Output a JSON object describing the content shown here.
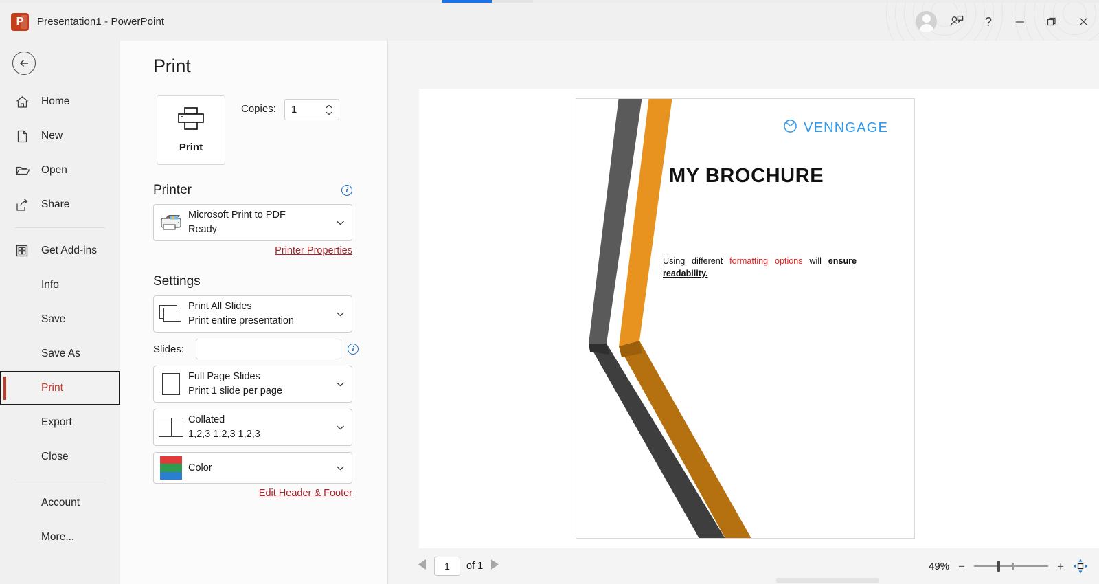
{
  "window": {
    "app_icon": "powerpoint-icon",
    "title": "Presentation1  -  PowerPoint",
    "controls": {
      "avatar": "account-avatar",
      "share_label": "person-share-icon",
      "help_label": "?",
      "minimize_label": "minimize-icon",
      "restore_label": "restore-icon",
      "close_label": "close-icon"
    }
  },
  "sidebar": {
    "back_label": "back-arrow-icon",
    "items": [
      {
        "label": "Home",
        "icon": "home-icon",
        "selected": false
      },
      {
        "label": "New",
        "icon": "page-icon",
        "selected": false
      },
      {
        "label": "Open",
        "icon": "folder-icon",
        "selected": false
      },
      {
        "label": "Share",
        "icon": "share-icon",
        "selected": false
      },
      {
        "label": "Get Add-ins",
        "icon": "addins-icon",
        "selected": false
      },
      {
        "label": "Info",
        "icon": "",
        "selected": false
      },
      {
        "label": "Save",
        "icon": "",
        "selected": false
      },
      {
        "label": "Save As",
        "icon": "",
        "selected": false
      },
      {
        "label": "Print",
        "icon": "",
        "selected": true
      },
      {
        "label": "Export",
        "icon": "",
        "selected": false
      },
      {
        "label": "Close",
        "icon": "",
        "selected": false
      },
      {
        "label": "Account",
        "icon": "",
        "selected": false
      },
      {
        "label": "More...",
        "icon": "",
        "selected": false
      }
    ],
    "selected_color": "#c0392b"
  },
  "print_pane": {
    "heading": "Print",
    "print_button_label": "Print",
    "print_button_icon": "printer-icon",
    "copies_label": "Copies:",
    "copies_value": "1",
    "printer_section": {
      "heading": "Printer",
      "info_icon": "i",
      "selected_name": "Microsoft Print to PDF",
      "selected_status": "Ready",
      "icon": "printer-device-icon",
      "properties_link": "Printer Properties"
    },
    "settings_section": {
      "heading": "Settings",
      "range": {
        "title": "Print All Slides",
        "subtitle": "Print entire presentation",
        "icon": "all-slides-icon"
      },
      "slides_label": "Slides:",
      "slides_value": "",
      "slides_placeholder": "",
      "slides_info_icon": "i",
      "layout": {
        "title": "Full Page Slides",
        "subtitle": "Print 1 slide per page",
        "icon": "full-page-icon"
      },
      "collation": {
        "title": "Collated",
        "subtitle": "1,2,3   1,2,3   1,2,3",
        "icon": "collated-icon"
      },
      "color": {
        "title": "Color",
        "subtitle": "",
        "icon": "color-icon",
        "swatches": [
          "#e03a3a",
          "#2e9b4f",
          "#2b7fd1"
        ]
      },
      "header_footer_link": "Edit Header & Footer"
    }
  },
  "preview": {
    "slide": {
      "logo_text": "VENNGAGE",
      "logo_icon": "venngage-clock-icon",
      "logo_color": "#2e9bf0",
      "title": "MY BROCHURE",
      "body": {
        "part1": "Using",
        "part2": "different",
        "part3": "formatting",
        "part4": "options",
        "part5": "will",
        "part6": "ensure readability.",
        "highlight_color": "#e8201f"
      },
      "graphic": {
        "name": "chevron-stripes-graphic",
        "gray_light": "#5a5a5a",
        "gray_dark": "#3a3a3a",
        "orange_light": "#e8931f",
        "orange_dark": "#b5700f"
      }
    }
  },
  "bottombar": {
    "prev_label": "previous-page-icon",
    "page_value": "1",
    "of_label": "of 1",
    "next_label": "next-page-icon",
    "zoom_percent": "49%",
    "zoom_out_label": "−",
    "zoom_in_label": "+",
    "fit_label": "zoom-to-page-icon"
  }
}
